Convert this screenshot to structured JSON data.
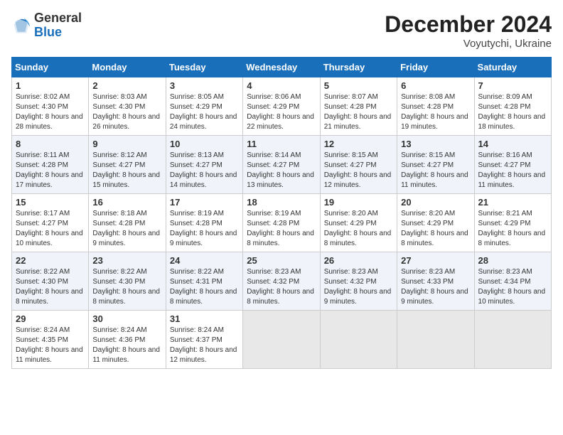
{
  "header": {
    "logo_line1": "General",
    "logo_line2": "Blue",
    "title": "December 2024",
    "subtitle": "Voyutychi, Ukraine"
  },
  "columns": [
    "Sunday",
    "Monday",
    "Tuesday",
    "Wednesday",
    "Thursday",
    "Friday",
    "Saturday"
  ],
  "weeks": [
    [
      {
        "day": "1",
        "sunrise": "8:02 AM",
        "sunset": "4:30 PM",
        "daylight": "8 hours and 28 minutes."
      },
      {
        "day": "2",
        "sunrise": "8:03 AM",
        "sunset": "4:30 PM",
        "daylight": "8 hours and 26 minutes."
      },
      {
        "day": "3",
        "sunrise": "8:05 AM",
        "sunset": "4:29 PM",
        "daylight": "8 hours and 24 minutes."
      },
      {
        "day": "4",
        "sunrise": "8:06 AM",
        "sunset": "4:29 PM",
        "daylight": "8 hours and 22 minutes."
      },
      {
        "day": "5",
        "sunrise": "8:07 AM",
        "sunset": "4:28 PM",
        "daylight": "8 hours and 21 minutes."
      },
      {
        "day": "6",
        "sunrise": "8:08 AM",
        "sunset": "4:28 PM",
        "daylight": "8 hours and 19 minutes."
      },
      {
        "day": "7",
        "sunrise": "8:09 AM",
        "sunset": "4:28 PM",
        "daylight": "8 hours and 18 minutes."
      }
    ],
    [
      {
        "day": "8",
        "sunrise": "8:11 AM",
        "sunset": "4:28 PM",
        "daylight": "8 hours and 17 minutes."
      },
      {
        "day": "9",
        "sunrise": "8:12 AM",
        "sunset": "4:27 PM",
        "daylight": "8 hours and 15 minutes."
      },
      {
        "day": "10",
        "sunrise": "8:13 AM",
        "sunset": "4:27 PM",
        "daylight": "8 hours and 14 minutes."
      },
      {
        "day": "11",
        "sunrise": "8:14 AM",
        "sunset": "4:27 PM",
        "daylight": "8 hours and 13 minutes."
      },
      {
        "day": "12",
        "sunrise": "8:15 AM",
        "sunset": "4:27 PM",
        "daylight": "8 hours and 12 minutes."
      },
      {
        "day": "13",
        "sunrise": "8:15 AM",
        "sunset": "4:27 PM",
        "daylight": "8 hours and 11 minutes."
      },
      {
        "day": "14",
        "sunrise": "8:16 AM",
        "sunset": "4:27 PM",
        "daylight": "8 hours and 11 minutes."
      }
    ],
    [
      {
        "day": "15",
        "sunrise": "8:17 AM",
        "sunset": "4:27 PM",
        "daylight": "8 hours and 10 minutes."
      },
      {
        "day": "16",
        "sunrise": "8:18 AM",
        "sunset": "4:28 PM",
        "daylight": "8 hours and 9 minutes."
      },
      {
        "day": "17",
        "sunrise": "8:19 AM",
        "sunset": "4:28 PM",
        "daylight": "8 hours and 9 minutes."
      },
      {
        "day": "18",
        "sunrise": "8:19 AM",
        "sunset": "4:28 PM",
        "daylight": "8 hours and 8 minutes."
      },
      {
        "day": "19",
        "sunrise": "8:20 AM",
        "sunset": "4:29 PM",
        "daylight": "8 hours and 8 minutes."
      },
      {
        "day": "20",
        "sunrise": "8:20 AM",
        "sunset": "4:29 PM",
        "daylight": "8 hours and 8 minutes."
      },
      {
        "day": "21",
        "sunrise": "8:21 AM",
        "sunset": "4:29 PM",
        "daylight": "8 hours and 8 minutes."
      }
    ],
    [
      {
        "day": "22",
        "sunrise": "8:22 AM",
        "sunset": "4:30 PM",
        "daylight": "8 hours and 8 minutes."
      },
      {
        "day": "23",
        "sunrise": "8:22 AM",
        "sunset": "4:30 PM",
        "daylight": "8 hours and 8 minutes."
      },
      {
        "day": "24",
        "sunrise": "8:22 AM",
        "sunset": "4:31 PM",
        "daylight": "8 hours and 8 minutes."
      },
      {
        "day": "25",
        "sunrise": "8:23 AM",
        "sunset": "4:32 PM",
        "daylight": "8 hours and 8 minutes."
      },
      {
        "day": "26",
        "sunrise": "8:23 AM",
        "sunset": "4:32 PM",
        "daylight": "8 hours and 9 minutes."
      },
      {
        "day": "27",
        "sunrise": "8:23 AM",
        "sunset": "4:33 PM",
        "daylight": "8 hours and 9 minutes."
      },
      {
        "day": "28",
        "sunrise": "8:23 AM",
        "sunset": "4:34 PM",
        "daylight": "8 hours and 10 minutes."
      }
    ],
    [
      {
        "day": "29",
        "sunrise": "8:24 AM",
        "sunset": "4:35 PM",
        "daylight": "8 hours and 11 minutes."
      },
      {
        "day": "30",
        "sunrise": "8:24 AM",
        "sunset": "4:36 PM",
        "daylight": "8 hours and 11 minutes."
      },
      {
        "day": "31",
        "sunrise": "8:24 AM",
        "sunset": "4:37 PM",
        "daylight": "8 hours and 12 minutes."
      },
      null,
      null,
      null,
      null
    ]
  ],
  "labels": {
    "sunrise": "Sunrise:",
    "sunset": "Sunset:",
    "daylight": "Daylight:"
  }
}
